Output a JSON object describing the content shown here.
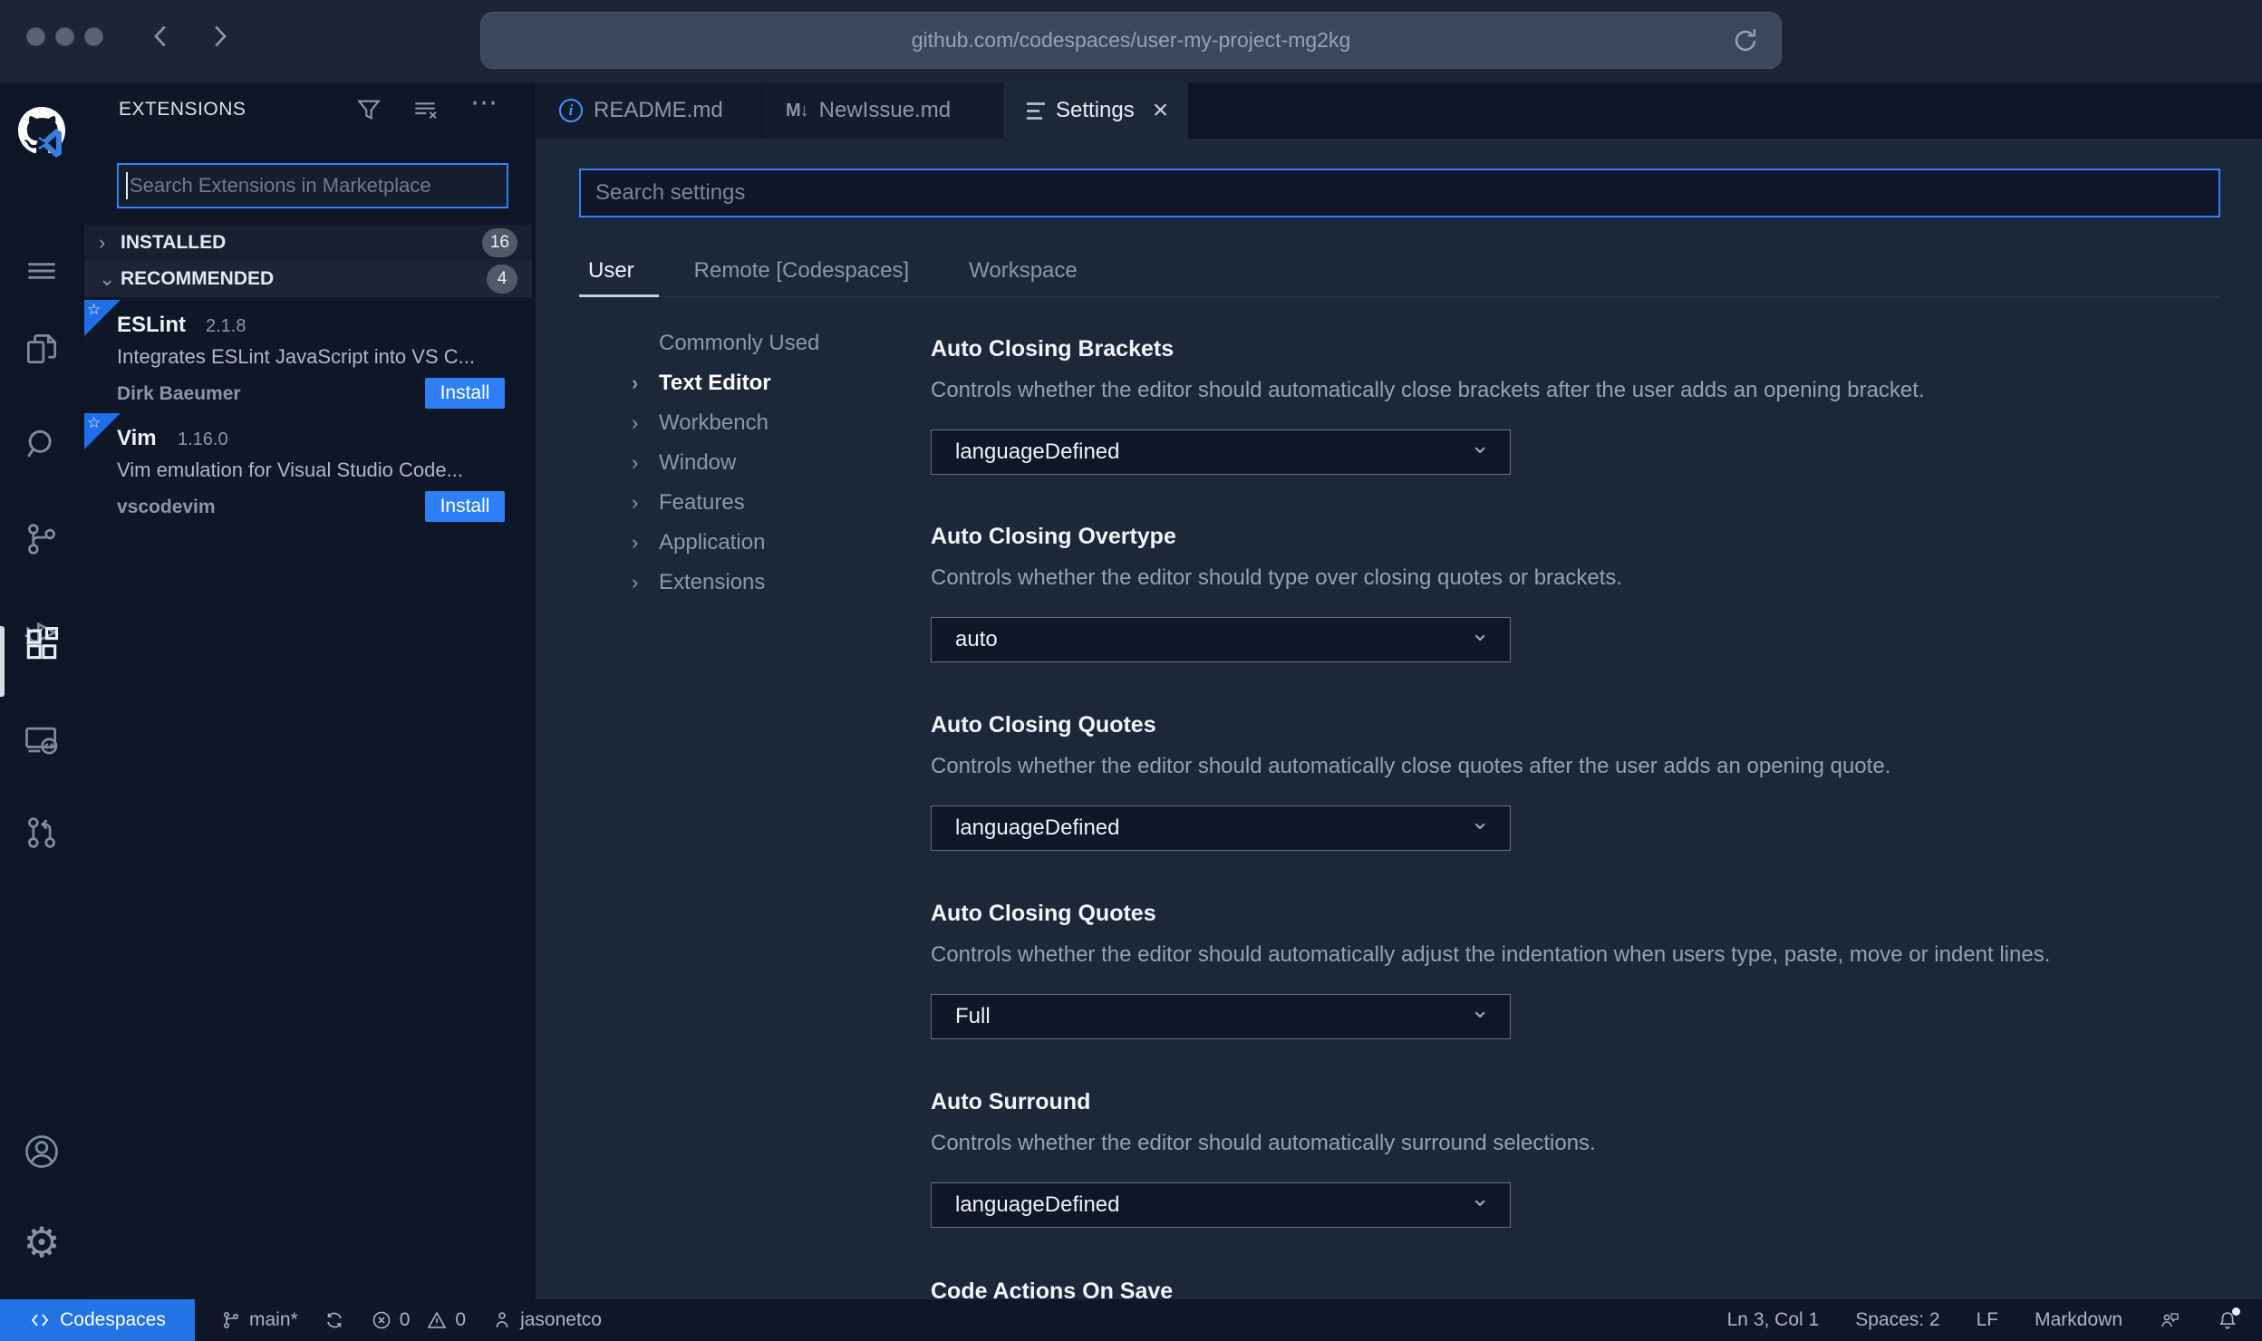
{
  "colors": {
    "accent": "#2f81f7",
    "install_button": "#2e80f6",
    "codespaces_button": "#2173e6",
    "editor_bg": "#1c273a",
    "panel_bg": "#0e1726",
    "ribbon_blue": "#1f6feb"
  },
  "icons": {
    "ellipsis": "⋯",
    "chevron_right": "›",
    "chevron_down": "⌄",
    "close": "×",
    "markdown": "M↓",
    "star": "☆",
    "dropdown_chevron": "⌄",
    "gear": "⚙",
    "info": "i"
  },
  "browser": {
    "url": "github.com/codespaces/user-my-project-mg2kg"
  },
  "sidebar": {
    "title": "EXTENSIONS",
    "search_placeholder": "Search Extensions in Marketplace",
    "sections": [
      {
        "label": "INSTALLED",
        "count": "16"
      },
      {
        "label": "RECOMMENDED",
        "count": "4"
      }
    ],
    "extensions": [
      {
        "name": "ESLint",
        "version": "2.1.8",
        "description": "Integrates ESLint JavaScript into VS C...",
        "author": "Dirk Baeumer",
        "action": "Install"
      },
      {
        "name": "Vim",
        "version": "1.16.0",
        "description": "Vim emulation for Visual Studio Code...",
        "author": "vscodevim",
        "action": "Install"
      }
    ]
  },
  "tabs": [
    {
      "label": "README.md"
    },
    {
      "label": "NewIssue.md"
    },
    {
      "label": "Settings"
    }
  ],
  "settings": {
    "search_placeholder": "Search settings",
    "scopes": [
      {
        "label": "User"
      },
      {
        "label": "Remote [Codespaces]"
      },
      {
        "label": "Workspace"
      }
    ],
    "tree": [
      {
        "label": "Commonly Used"
      },
      {
        "label": "Text Editor"
      },
      {
        "label": "Workbench"
      },
      {
        "label": "Window"
      },
      {
        "label": "Features"
      },
      {
        "label": "Application"
      },
      {
        "label": "Extensions"
      }
    ],
    "entries": [
      {
        "title": "Auto Closing Brackets",
        "description": "Controls whether the editor should automatically close brackets after the user adds an opening bracket.",
        "value": "languageDefined"
      },
      {
        "title": "Auto Closing Overtype",
        "description": "Controls whether the editor should type over closing quotes or brackets.",
        "value": "auto"
      },
      {
        "title": "Auto Closing Quotes",
        "description": "Controls whether the editor should automatically close quotes after the user adds an opening quote.",
        "value": "languageDefined"
      },
      {
        "title": "Auto Closing Quotes",
        "description": "Controls whether the editor should automatically adjust the indentation when users type, paste, move or indent lines.",
        "value": "Full"
      },
      {
        "title": "Auto Surround",
        "description": "Controls whether the editor should automatically surround selections.",
        "value": "languageDefined"
      },
      {
        "title": "Code Actions On Save"
      }
    ]
  },
  "status_bar": {
    "codespaces": "Codespaces",
    "branch": "main*",
    "errors": "0",
    "warnings": "0",
    "user": "jasonetco",
    "line_col": "Ln 3, Col 1",
    "spaces": "Spaces: 2",
    "eol": "LF",
    "language": "Markdown"
  }
}
